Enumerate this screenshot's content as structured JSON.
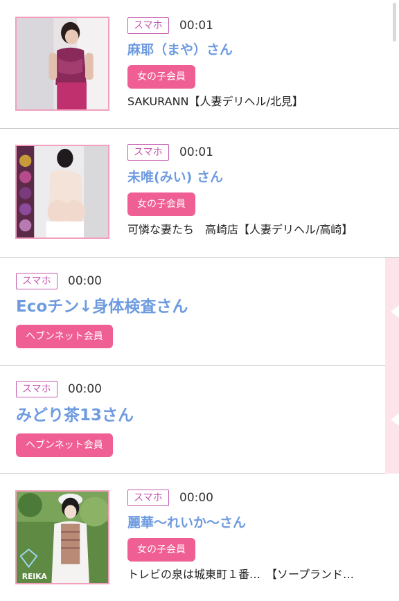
{
  "items": [
    {
      "platform": "スマホ",
      "time": "00:01",
      "name": "麻耶（まや）さん",
      "member_type": "女の子会員",
      "shop": "SAKURANN【人妻デリヘル/北見】",
      "thumbnail": "photo"
    },
    {
      "platform": "スマホ",
      "time": "00:01",
      "name": "未唯(みい) さん",
      "member_type": "女の子会員",
      "shop": "可憐な妻たち　高崎店【人妻デリヘル/高崎】",
      "thumbnail": "photo"
    },
    {
      "platform": "スマホ",
      "time": "00:00",
      "name": "Ecoチン↓身体検査さん",
      "member_type": "ヘブンネット会員"
    },
    {
      "platform": "スマホ",
      "time": "00:00",
      "name": "みどり茶13さん",
      "member_type": "ヘブンネット会員"
    },
    {
      "platform": "スマホ",
      "time": "00:00",
      "name": "麗華〜れいか〜さん",
      "member_type": "女の子会員",
      "shop": "トレビの泉は城東町１番…　【ソープランド…",
      "thumbnail": "photo",
      "thumbnail_watermark": "REIKA"
    }
  ],
  "colors": {
    "accent_pink": "#ef5f93",
    "badge_purple": "#c45ab0",
    "name_blue": "#6e9be0",
    "thumb_border": "#f2a0be",
    "side_accent": "#fde4ea"
  }
}
